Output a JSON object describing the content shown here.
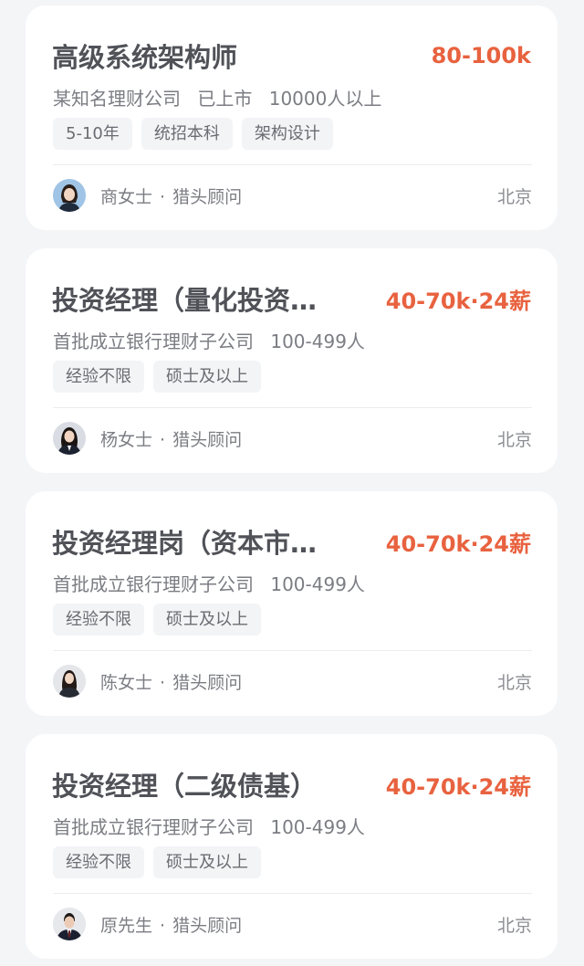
{
  "jobs": [
    {
      "title": "高级系统架构师",
      "salary": "80-100k",
      "company": "某知名理财公司",
      "company_status": "已上市",
      "company_size": "10000人以上",
      "tags": [
        "5-10年",
        "统招本科",
        "架构设计"
      ],
      "recruiter_name": "商女士",
      "recruiter_role": "猎头顾问",
      "city": "北京",
      "avatar_icon": "woman-portrait-icon"
    },
    {
      "title": "投资经理（量化投资…",
      "salary": "40-70k·24薪",
      "company": "首批成立银行理财子公司",
      "company_status": "",
      "company_size": "100-499人",
      "tags": [
        "经验不限",
        "硕士及以上"
      ],
      "recruiter_name": "杨女士",
      "recruiter_role": "猎头顾问",
      "city": "北京",
      "avatar_icon": "woman-portrait-icon"
    },
    {
      "title": "投资经理岗（资本市…",
      "salary": "40-70k·24薪",
      "company": "首批成立银行理财子公司",
      "company_status": "",
      "company_size": "100-499人",
      "tags": [
        "经验不限",
        "硕士及以上"
      ],
      "recruiter_name": "陈女士",
      "recruiter_role": "猎头顾问",
      "city": "北京",
      "avatar_icon": "woman-portrait-icon"
    },
    {
      "title": "投资经理（二级债基）",
      "salary": "40-70k·24薪",
      "company": "首批成立银行理财子公司",
      "company_status": "",
      "company_size": "100-499人",
      "tags": [
        "经验不限",
        "硕士及以上"
      ],
      "recruiter_name": "原先生",
      "recruiter_role": "猎头顾问",
      "city": "北京",
      "avatar_icon": "man-portrait-icon"
    }
  ],
  "separator": "·",
  "colors": {
    "salary": "#e8623f",
    "title": "#505258",
    "background": "#f4f5f7",
    "card": "#ffffff"
  }
}
